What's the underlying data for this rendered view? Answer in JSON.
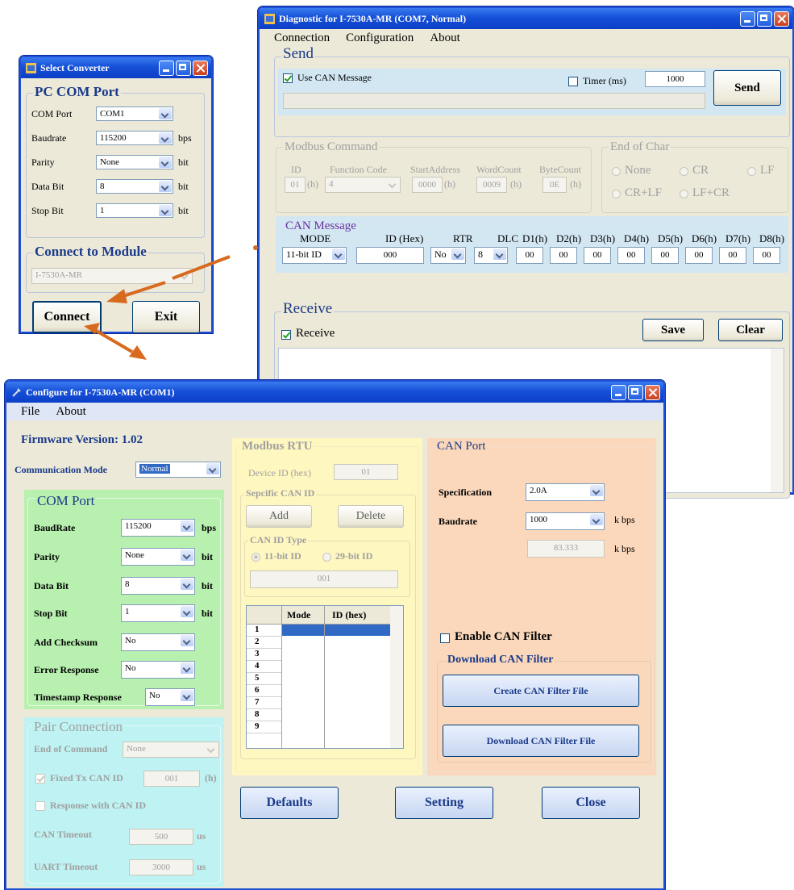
{
  "select_converter": {
    "title": "Select Converter",
    "pc_com_port": {
      "legend": "PC COM Port",
      "com_port": {
        "label": "COM Port",
        "value": "COM1"
      },
      "baudrate": {
        "label": "Baudrate",
        "value": "115200",
        "unit": "bps"
      },
      "parity": {
        "label": "Parity",
        "value": "None",
        "unit": "bit"
      },
      "data_bit": {
        "label": "Data Bit",
        "value": "8",
        "unit": "bit"
      },
      "stop_bit": {
        "label": "Stop Bit",
        "value": "1",
        "unit": "bit"
      }
    },
    "connect_to_module": {
      "legend": "Connect to Module",
      "value": "I-7530A-MR"
    },
    "connect_label": "Connect",
    "exit_label": "Exit"
  },
  "diagnostic": {
    "title": "Diagnostic for I-7530A-MR (COM7, Normal)",
    "menu": [
      "Connection",
      "Configuration",
      "About"
    ],
    "send": {
      "legend": "Send",
      "use_can_message": "Use CAN Message",
      "timer_label": "Timer (ms)",
      "timer_value": "1000",
      "send_label": "Send"
    },
    "modbus_command": {
      "legend": "Modbus Command",
      "id_label": "ID",
      "id_value": "01",
      "h": "(h)",
      "function_code_label": "Function Code",
      "function_code_value": "4",
      "start_address_label": "StartAddress",
      "start_address_value": "0000",
      "word_count_label": "WordCount",
      "word_count_value": "0009",
      "byte_count_label": "ByteCount",
      "byte_count_value": "0E"
    },
    "end_of_char": {
      "legend": "End of Char",
      "options": [
        "None",
        "CR",
        "LF",
        "CR+LF",
        "LF+CR"
      ]
    },
    "can_message": {
      "legend": "CAN Message",
      "headers": [
        "MODE",
        "ID (Hex)",
        "RTR",
        "DLC",
        "D1(h)",
        "D2(h)",
        "D3(h)",
        "D4(h)",
        "D5(h)",
        "D6(h)",
        "D7(h)",
        "D8(h)"
      ],
      "mode_value": "11-bit ID",
      "id_value": "000",
      "rtr_value": "No",
      "dlc_value": "8",
      "data": [
        "00",
        "00",
        "00",
        "00",
        "00",
        "00",
        "00",
        "00"
      ]
    },
    "receive": {
      "legend": "Receive",
      "checkbox_label": "Receive",
      "save_label": "Save",
      "clear_label": "Clear"
    }
  },
  "configure": {
    "title": "Configure for I-7530A-MR (COM1)",
    "menu": [
      "File",
      "About"
    ],
    "firmware_version": "Firmware Version: 1.02",
    "communication_mode": {
      "label": "Communication Mode",
      "value": "Normal"
    },
    "com_port": {
      "legend": "COM Port",
      "baudrate": {
        "label": "BaudRate",
        "value": "115200",
        "unit": "bps"
      },
      "parity": {
        "label": "Parity",
        "value": "None",
        "unit": "bit"
      },
      "data_bit": {
        "label": "Data Bit",
        "value": "8",
        "unit": "bit"
      },
      "stop_bit": {
        "label": "Stop Bit",
        "value": "1",
        "unit": "bit"
      },
      "add_checksum": {
        "label": "Add Checksum",
        "value": "No"
      },
      "error_response": {
        "label": "Error Response",
        "value": "No"
      },
      "timestamp_response": {
        "label": "Timestamp Response",
        "value": "No"
      }
    },
    "pair_connection": {
      "legend": "Pair Connection",
      "end_of_command": {
        "label": "End of Command",
        "value": "None"
      },
      "fixed_tx_can_id": {
        "label": "Fixed Tx CAN ID",
        "value": "001",
        "unit": "(h)"
      },
      "response_with_can_id": "Response with CAN ID",
      "can_timeout": {
        "label": "CAN Timeout",
        "value": "500",
        "unit": "us"
      },
      "uart_timeout": {
        "label": "UART Timeout",
        "value": "3000",
        "unit": "us"
      }
    },
    "modbus_rtu": {
      "legend": "Modbus RTU",
      "device_id_label": "Device ID (hex)",
      "device_id_value": "01",
      "specific_can_id": {
        "legend": "Sepcific CAN ID",
        "add_label": "Add",
        "delete_label": "Delete",
        "can_id_type": {
          "legend": "CAN ID Type",
          "option_11": "11-bit ID",
          "option_29": "29-bit ID",
          "value": "001"
        }
      },
      "table": {
        "headers": [
          "Mode",
          "ID (hex)"
        ],
        "row_numbers": [
          "1",
          "2",
          "3",
          "4",
          "5",
          "6",
          "7",
          "8",
          "9"
        ]
      }
    },
    "can_port": {
      "legend": "CAN Port",
      "specification": {
        "label": "Specification",
        "value": "2.0A"
      },
      "baudrate": {
        "label": "Baudrate",
        "value": "1000",
        "unit": "k bps"
      },
      "actual_baud": {
        "value": "83.333",
        "unit": "k bps"
      },
      "enable_can_filter": "Enable CAN Filter",
      "download_can_filter": {
        "legend": "Download CAN Filter",
        "create_label": "Create CAN Filter File",
        "download_label": "Download CAN Filter File"
      }
    },
    "defaults_label": "Defaults",
    "setting_label": "Setting",
    "close_label": "Close"
  },
  "colors": {
    "title_blue": "#1550d8",
    "arrow_orange": "#d86a20",
    "com_port_green": "#b8f0b0",
    "pair_cyan": "#bff2f2",
    "modbus_yellow": "#fff7c0",
    "can_port_peach": "#fbd8bb",
    "can_message_blue": "#d3e7f3"
  }
}
